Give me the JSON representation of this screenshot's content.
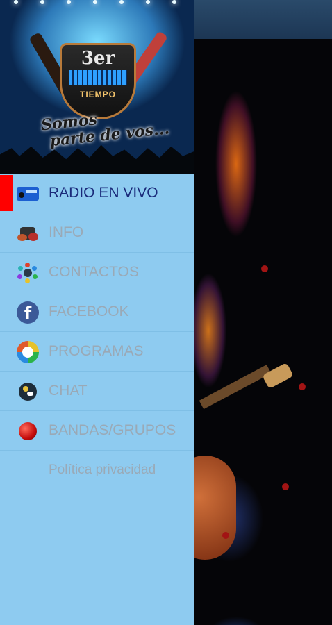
{
  "drawer": {
    "header": {
      "logo_number": "3er",
      "logo_word": "TIEMPO",
      "slogan_line1": "Somos",
      "slogan_line2": "parte de vos..."
    },
    "menu": [
      {
        "label": "RADIO EN VIVO",
        "icon": "radio-icon",
        "active": true
      },
      {
        "label": "INFO",
        "icon": "info-guitar-icon",
        "active": false
      },
      {
        "label": "CONTACTOS",
        "icon": "contacts-icon",
        "active": false
      },
      {
        "label": "FACEBOOK",
        "icon": "facebook-icon",
        "active": false
      },
      {
        "label": "PROGRAMAS",
        "icon": "programs-icon",
        "active": false
      },
      {
        "label": "CHAT",
        "icon": "chat-icon",
        "active": false
      },
      {
        "label": "BANDAS/GRUPOS",
        "icon": "bands-icon",
        "active": false
      },
      {
        "label": "Política privacidad",
        "icon": "",
        "active": false
      }
    ],
    "colors": {
      "background": "#8ecbf0",
      "active_indicator": "#ff0000",
      "active_text": "#1a2a7a",
      "inactive_text": "#9aa9b6"
    }
  },
  "app_bar": {
    "color": "#1f3a5c"
  }
}
